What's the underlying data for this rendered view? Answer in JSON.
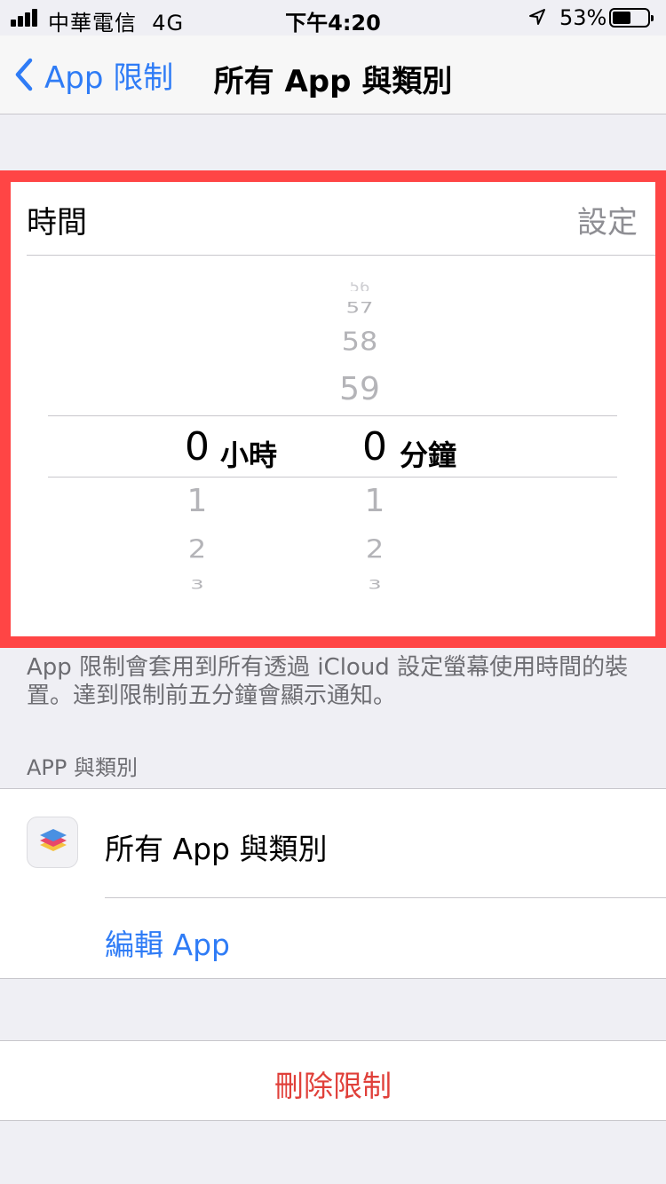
{
  "status_bar": {
    "carrier": "中華電信",
    "network": "4G",
    "time": "下午4:20",
    "battery_percent": "53%",
    "battery_level": 0.53,
    "icons": [
      "signal-bars-icon",
      "location-arrow-icon",
      "battery-icon"
    ]
  },
  "nav": {
    "back_label": "App 限制",
    "title": "所有 App 與類別"
  },
  "time_card": {
    "title": "時間",
    "action": "設定",
    "picker": {
      "hours_above": [],
      "minutes_above": [
        "57",
        "58",
        "59"
      ],
      "minutes_above_partial": "56",
      "hours_selected": "0",
      "hours_unit": "小時",
      "minutes_selected": "0",
      "minutes_unit": "分鐘",
      "hours_below": [
        "1",
        "2",
        "3"
      ],
      "minutes_below": [
        "1",
        "2",
        "3"
      ]
    }
  },
  "note": "App 限制會套用到所有透過 iCloud 設定螢幕使用時間的裝置。達到限制前五分鐘會顯示通知。",
  "section_header": "APP 與類別",
  "apps_group": {
    "item_label": "所有 App 與類別",
    "item_icon": "stacked-layers-icon",
    "edit_label": "編輯 App"
  },
  "delete_label": "刪除限制",
  "colors": {
    "accent": "#2f7cf6",
    "destructive": "#e0403a",
    "highlight_border": "#ff4545",
    "background": "#efeff4"
  }
}
